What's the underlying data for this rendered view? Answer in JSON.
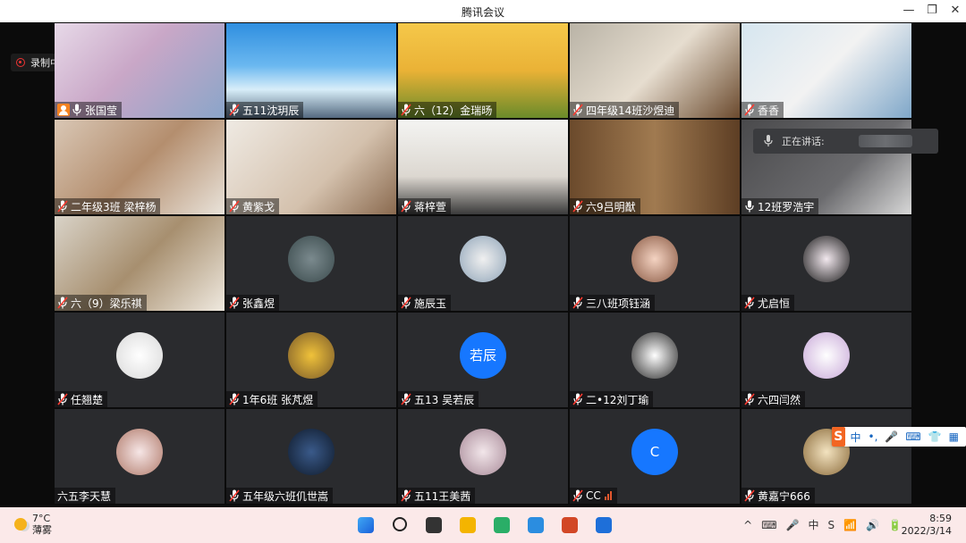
{
  "window": {
    "title": "腾讯会议",
    "minimize_glyph": "—",
    "restore_glyph": "❐",
    "close_glyph": "✕"
  },
  "recording": {
    "label": "录制中"
  },
  "speaking": {
    "label": "正在讲话:"
  },
  "participants": [
    {
      "name": "张国莹",
      "host": true,
      "mic": "on",
      "kind": "video",
      "bg": "linear-gradient(135deg,#e7d9e8 0%,#c9a7c7 45%,#8aa5c9 100%)"
    },
    {
      "name": "五11沈玥辰",
      "mic": "muted",
      "kind": "video",
      "bg": "linear-gradient(180deg,#2f8fe0 0%,#6bb8f0 45%,#d8eef9 70%,#556a80 100%)"
    },
    {
      "name": "六（12）金瑞旸",
      "mic": "muted",
      "kind": "video",
      "bg": "linear-gradient(180deg,#f5c84a 0%,#eab236 50%,#6a8b2a 100%)"
    },
    {
      "name": "四年级14班沙煜迪",
      "mic": "muted",
      "kind": "video",
      "bg": "linear-gradient(135deg,#b9b3a6 0%,#e6ddcf 50%,#6b4a2e 100%)"
    },
    {
      "name": "香香",
      "mic": "muted",
      "kind": "video",
      "bg": "linear-gradient(135deg,#d6e6f0 0%,#f2f2f2 50%,#7fa7c9 100%)"
    },
    {
      "name": "二年级3班 梁梓杨",
      "mic": "muted",
      "kind": "video",
      "bg": "linear-gradient(135deg,#d9c7b5 0%,#b48e6e 50%,#e9e3da 100%)"
    },
    {
      "name": "黄紫戈",
      "mic": "muted",
      "kind": "video",
      "bg": "linear-gradient(135deg,#efeae3 0%,#d4c1ad 60%,#8a6a4f 100%)"
    },
    {
      "name": "蒋梓萱",
      "mic": "muted",
      "kind": "video",
      "bg": "linear-gradient(180deg,#f4f4f2 0%,#dcd7d0 60%,#3a3a3a 100%)"
    },
    {
      "name": "六9吕明猷",
      "mic": "muted",
      "kind": "video",
      "bg": "linear-gradient(90deg,#6b4a2c 0%,#a07a50 50%,#5d3e24 100%)"
    },
    {
      "name": "12班罗浩宇",
      "mic": "on",
      "kind": "video",
      "bg": "linear-gradient(135deg,#4a4a4c 0%,#6b6b6e 60%,#d8d8d8 100%)"
    },
    {
      "name": "六（9）梁乐祺",
      "mic": "muted",
      "kind": "video",
      "bg": "linear-gradient(135deg,#d9d3c8 0%,#a78f6f 50%,#efe9df 100%)"
    },
    {
      "name": "张鑫煜",
      "mic": "muted",
      "kind": "avatar",
      "avatar_bg": "radial-gradient(circle,#7b8a8e 0%,#3a4a4c 100%)"
    },
    {
      "name": "施辰玉",
      "mic": "muted",
      "kind": "avatar",
      "avatar_bg": "radial-gradient(circle,#f0f0f0 0%,#8fa4b8 100%)"
    },
    {
      "name": "三八班项钰涵",
      "mic": "muted",
      "kind": "avatar",
      "avatar_bg": "radial-gradient(circle,#f4d3c2 0%,#8a5a44 100%)"
    },
    {
      "name": "尤启恒",
      "mic": "muted",
      "kind": "avatar",
      "avatar_bg": "radial-gradient(circle,#f2e8ee 0%,#1a1a1a 100%)"
    },
    {
      "name": "任翘楚",
      "mic": "muted",
      "kind": "avatar",
      "avatar_bg": "radial-gradient(circle,#ffffff 0%,#d9d9d9 100%)"
    },
    {
      "name": "1年6班 张芃煜",
      "mic": "muted",
      "kind": "avatar",
      "avatar_bg": "radial-gradient(circle,#f0c23a 0%,#7a5a2a 100%)"
    },
    {
      "name": "五13 吴若辰",
      "mic": "muted",
      "kind": "text-avatar",
      "avatar_text": "若辰",
      "avatar_color": "#1677ff"
    },
    {
      "name": "二•12刘丁瑜",
      "mic": "muted",
      "kind": "avatar",
      "avatar_bg": "radial-gradient(circle,#ffffff 0%,#2a2a2a 100%)"
    },
    {
      "name": "六四闫然",
      "mic": "muted",
      "kind": "avatar",
      "avatar_bg": "radial-gradient(circle,#ffffff 0%,#c8a8d8 100%)"
    },
    {
      "name": "六五李天慧",
      "mic": "none",
      "kind": "avatar",
      "avatar_bg": "radial-gradient(circle,#f6e6e6 0%,#b07a6a 100%)"
    },
    {
      "name": "五年级六班仉世嵩",
      "mic": "muted",
      "kind": "avatar",
      "avatar_bg": "radial-gradient(circle,#3a5a8a 0%,#0f1a2a 100%)"
    },
    {
      "name": "五11王美茜",
      "mic": "muted",
      "kind": "avatar",
      "avatar_bg": "radial-gradient(circle,#f2e6ea 0%,#a88a98 100%)"
    },
    {
      "name": "CC",
      "mic": "muted",
      "kind": "text-avatar",
      "avatar_text": "C",
      "avatar_color": "#1677ff",
      "signal": true
    },
    {
      "name": "黄嘉宁666",
      "mic": "muted",
      "kind": "avatar",
      "avatar_bg": "radial-gradient(circle,#f3e3c0 0%,#8a6a3a 100%)"
    }
  ],
  "ime": {
    "logo": "S",
    "items": [
      "中",
      "•,",
      "🎤",
      "⌨",
      "👕",
      "▦"
    ]
  },
  "taskbar": {
    "weather_temp": "7°C",
    "weather_desc": "薄雾",
    "apps": [
      {
        "name": "start-icon",
        "color": "#1a73e8"
      },
      {
        "name": "search-icon",
        "color": "#222222"
      },
      {
        "name": "task-view-icon",
        "color": "#333333"
      },
      {
        "name": "file-explorer-icon",
        "color": "#f4b400"
      },
      {
        "name": "wechat-icon",
        "color": "#2aae67"
      },
      {
        "name": "sogou-browser-icon",
        "color": "#2b8de0"
      },
      {
        "name": "powerpoint-icon",
        "color": "#d24726"
      },
      {
        "name": "tencent-meeting-icon",
        "color": "#1e6fd9"
      }
    ],
    "tray": [
      "^",
      "⌨",
      "🎤",
      "中",
      "S",
      "📶",
      "🔊",
      "🔋"
    ],
    "time": "8:59",
    "date": "2022/3/14"
  }
}
